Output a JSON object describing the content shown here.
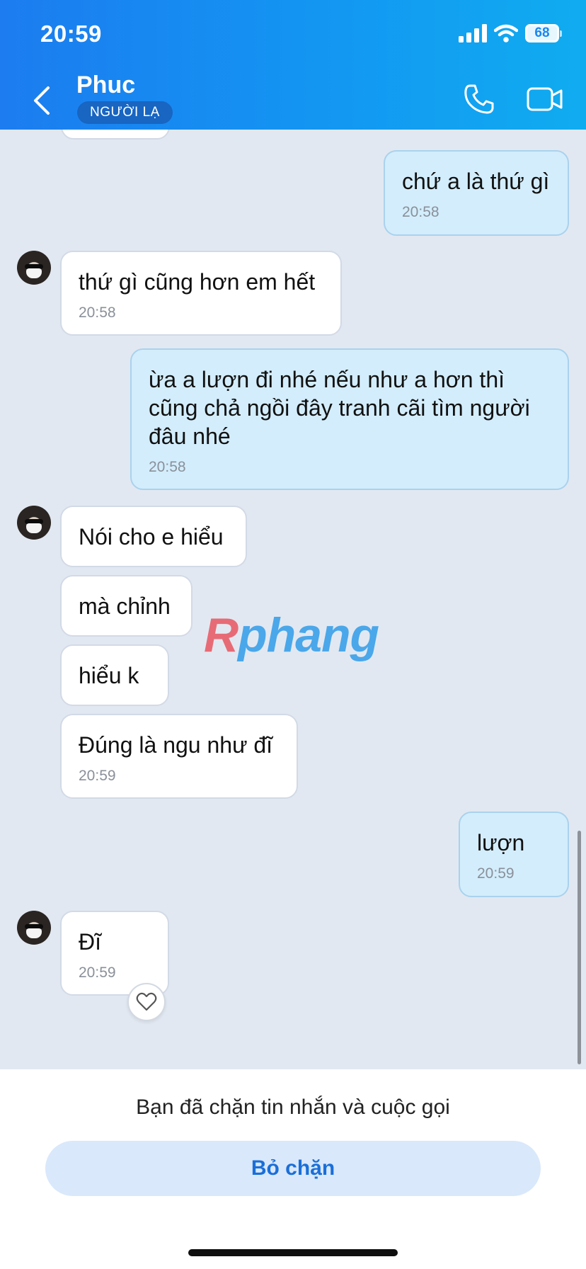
{
  "status_bar": {
    "time": "20:59",
    "battery": "68"
  },
  "header": {
    "contact_name": "Phuc",
    "badge": "NGƯỜI LẠ"
  },
  "watermark": {
    "first": "R",
    "rest": "phang"
  },
  "messages": [
    {
      "side": "out",
      "text": "chứ a là thứ gì",
      "time": "20:58"
    },
    {
      "side": "in",
      "text": "thứ gì cũng hơn em hết",
      "time": "20:58"
    },
    {
      "side": "out",
      "text": "ừa a lượn đi nhé nếu như a hơn thì cũng chả ngồi đây tranh cãi tìm người đâu nhé",
      "time": "20:58"
    },
    {
      "side": "in",
      "text": "Nói cho e hiểu"
    },
    {
      "side": "in",
      "text": "mà chỉnh"
    },
    {
      "side": "in",
      "text": "hiểu k"
    },
    {
      "side": "in",
      "text": "Đúng là ngu như đĩ",
      "time": "20:59"
    },
    {
      "side": "out",
      "text": "lượn",
      "time": "20:59"
    },
    {
      "side": "in",
      "text": "Đĩ",
      "time": "20:59"
    }
  ],
  "footer": {
    "blocked_note": "Bạn đã chặn tin nhắn và cuộc gọi",
    "unblock_label": "Bỏ chặn"
  },
  "icons": [
    "signal-icon",
    "wifi-icon",
    "battery-icon",
    "back-icon",
    "phone-icon",
    "video-call-icon",
    "heart-icon"
  ],
  "colors": {
    "header_start": "#1c7cf0",
    "header_end": "#10acf0",
    "outgoing_bubble": "#d3edfc",
    "incoming_bubble": "#ffffff",
    "chat_background": "#e2e8f1",
    "accent": "#1a6fd8"
  }
}
